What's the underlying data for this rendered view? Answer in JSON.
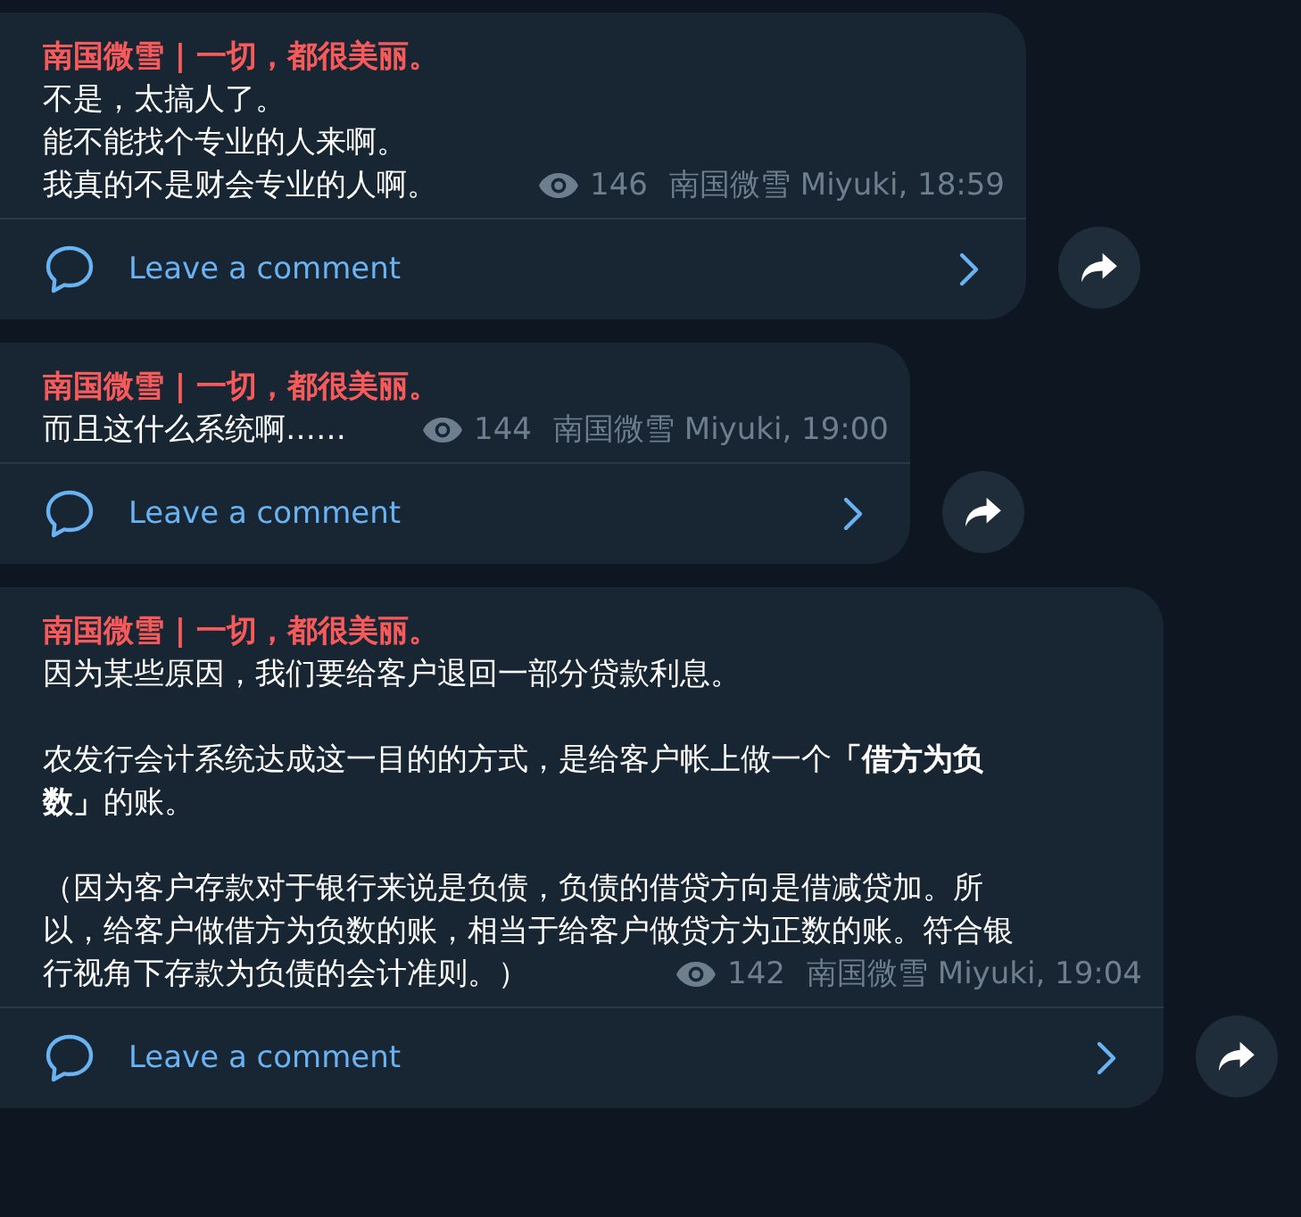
{
  "messages": [
    {
      "channel": "南国微雪 | 一切，都很美丽。",
      "paragraphs": [
        [
          "不是，太搞人了。",
          "能不能找个专业的人来啊。",
          "我真的不是财会专业的人啊。"
        ]
      ],
      "views": "146",
      "signature": "南国微雪 Miyuki, 18:59",
      "comment": "Leave a comment"
    },
    {
      "channel": "南国微雪 | 一切，都很美丽。",
      "paragraphs": [
        [
          "而且这什么系统啊……"
        ]
      ],
      "views": "144",
      "signature": "南国微雪 Miyuki, 19:00",
      "comment": "Leave a comment"
    },
    {
      "channel": "南国微雪 | 一切，都很美丽。",
      "paragraphs": [
        [
          "因为某些原因，我们要给客户退回一部分贷款利息。"
        ],
        [
          "农发行会计系统达成这一目的的方式，是给客户帐上做一个**「借方为负**",
          "**数」**的账。"
        ],
        [
          "（因为客户存款对于银行来说是负债，负债的借贷方向是借减贷加。所",
          "以，给客户做借方为负数的账，相当于给客户做贷方为正数的账。符合银",
          "行视角下存款为负债的会计准则。）"
        ]
      ],
      "views": "142",
      "signature": "南国微雪 Miyuki, 19:04",
      "comment": "Leave a comment"
    }
  ]
}
